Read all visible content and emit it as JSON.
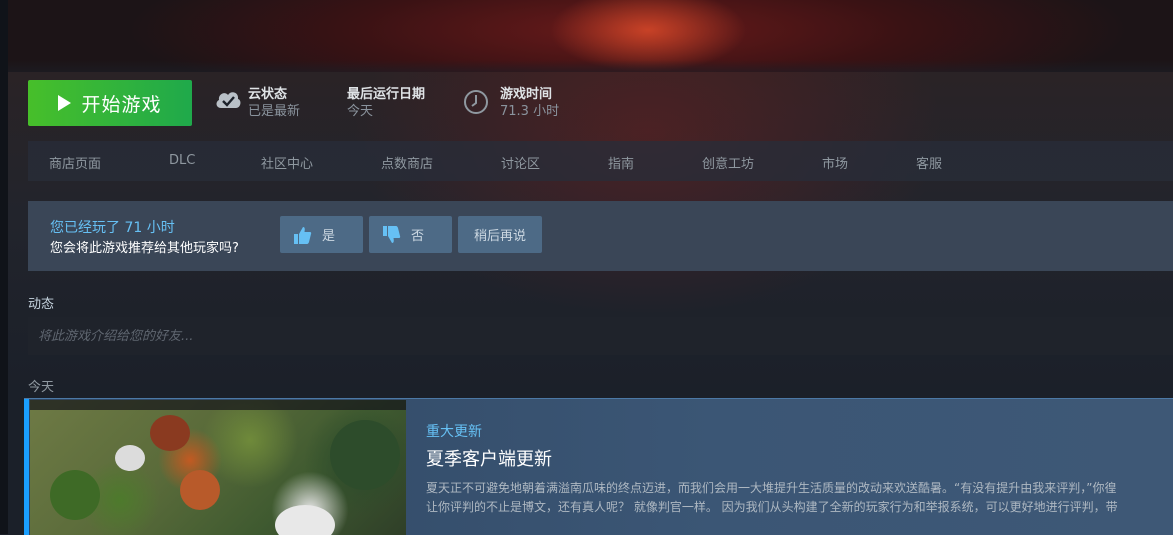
{
  "play": {
    "label": "开始游戏"
  },
  "stats": {
    "cloud": {
      "title": "云状态",
      "value": "已是最新"
    },
    "last_played": {
      "title": "最后运行日期",
      "value": "今天"
    },
    "playtime": {
      "title": "游戏时间",
      "value": "71.3 小时"
    }
  },
  "nav": {
    "items": [
      {
        "label": "商店页面"
      },
      {
        "label": "DLC"
      },
      {
        "label": "社区中心"
      },
      {
        "label": "点数商店"
      },
      {
        "label": "讨论区"
      },
      {
        "label": "指南"
      },
      {
        "label": "创意工坊"
      },
      {
        "label": "市场"
      },
      {
        "label": "客服"
      }
    ]
  },
  "review": {
    "played": "您已经玩了 71 小时",
    "question": "您会将此游戏推荐给其他玩家吗?",
    "yes": "是",
    "no": "否",
    "later": "稍后再说"
  },
  "activity": {
    "label": "动态",
    "placeholder": "将此游戏介绍给您的好友..."
  },
  "feed": {
    "date_label": "今天",
    "news": {
      "tag": "重大更新",
      "title": "夏季客户端更新",
      "body_line1": "夏天正不可避免地朝着满溢南瓜味的终点迈进，而我们会用一大堆提升生活质量的改动来欢送酷暑。“有没有提升由我来评判，”你徨",
      "body_line2": "让你评判的不止是博文，还有真人呢？ 就像判官一样。 因为我们从头构建了全新的玩家行为和举报系统，可以更好地进行评判，带"
    }
  },
  "colors": {
    "accent": "#66c0f4",
    "play_green": "#47bf2a",
    "news_accent": "#1a9fff"
  }
}
